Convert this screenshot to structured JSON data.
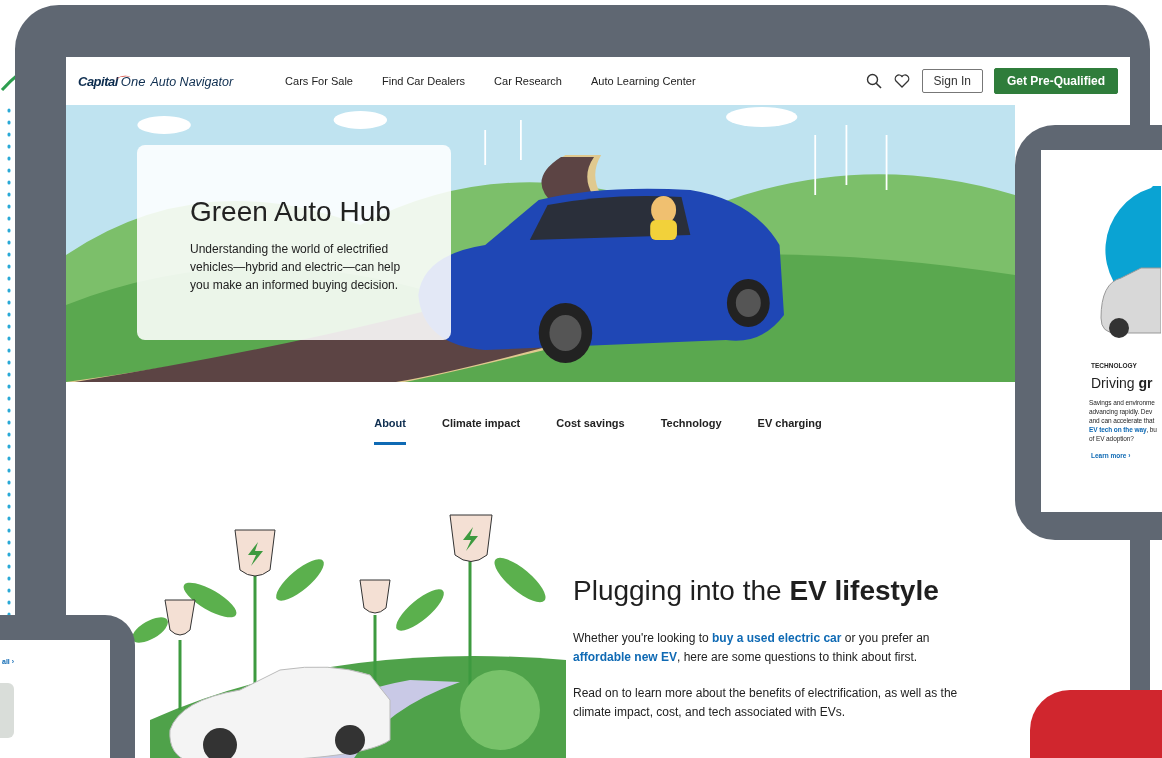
{
  "header": {
    "logo": {
      "brand": "Capital",
      "brand_one": "One",
      "product": "Auto Navigator"
    },
    "nav": [
      "Cars For Sale",
      "Find Car Dealers",
      "Car Research",
      "Auto Learning Center"
    ],
    "sign_in": "Sign In",
    "cta": "Get Pre-Qualified"
  },
  "hero": {
    "title": "Green Auto Hub",
    "text": "Understanding the world of electrified vehicles—hybrid and electric—can help you make an informed buying decision."
  },
  "tabs": [
    {
      "label": "About",
      "selected": true
    },
    {
      "label": "Climate impact",
      "selected": false
    },
    {
      "label": "Cost savings",
      "selected": false
    },
    {
      "label": "Technology",
      "selected": false
    },
    {
      "label": "EV charging",
      "selected": false
    }
  ],
  "article": {
    "heading": "Plugging into the **EV lifestyle**",
    "paragraphs": [
      [
        {
          "text": "Whether you're looking to "
        },
        {
          "link": "buy a used electric car"
        },
        {
          "text": " or you prefer an "
        },
        {
          "link": "affordable new EV"
        },
        {
          "text": ", here are some questions to think about first."
        }
      ],
      [
        {
          "text": "Read on to learn more about the benefits of electrification, as well as the climate impact, cost, and tech associated with EVs."
        }
      ]
    ]
  },
  "side_preview": {
    "eyebrow": "TECHNOLOGY",
    "title": "Driving **gr**",
    "lines": [
      {
        "text": "Savings and environme"
      },
      {
        "text": "advancing rapidly.  Dev"
      },
      {
        "text": "and can accelerate that"
      },
      {
        "link": "EV tech on the way",
        "text": ", bu"
      },
      {
        "text": "of EV adoption?"
      }
    ],
    "link": "Learn more ›"
  },
  "corner_preview": {
    "link": "all ›"
  }
}
